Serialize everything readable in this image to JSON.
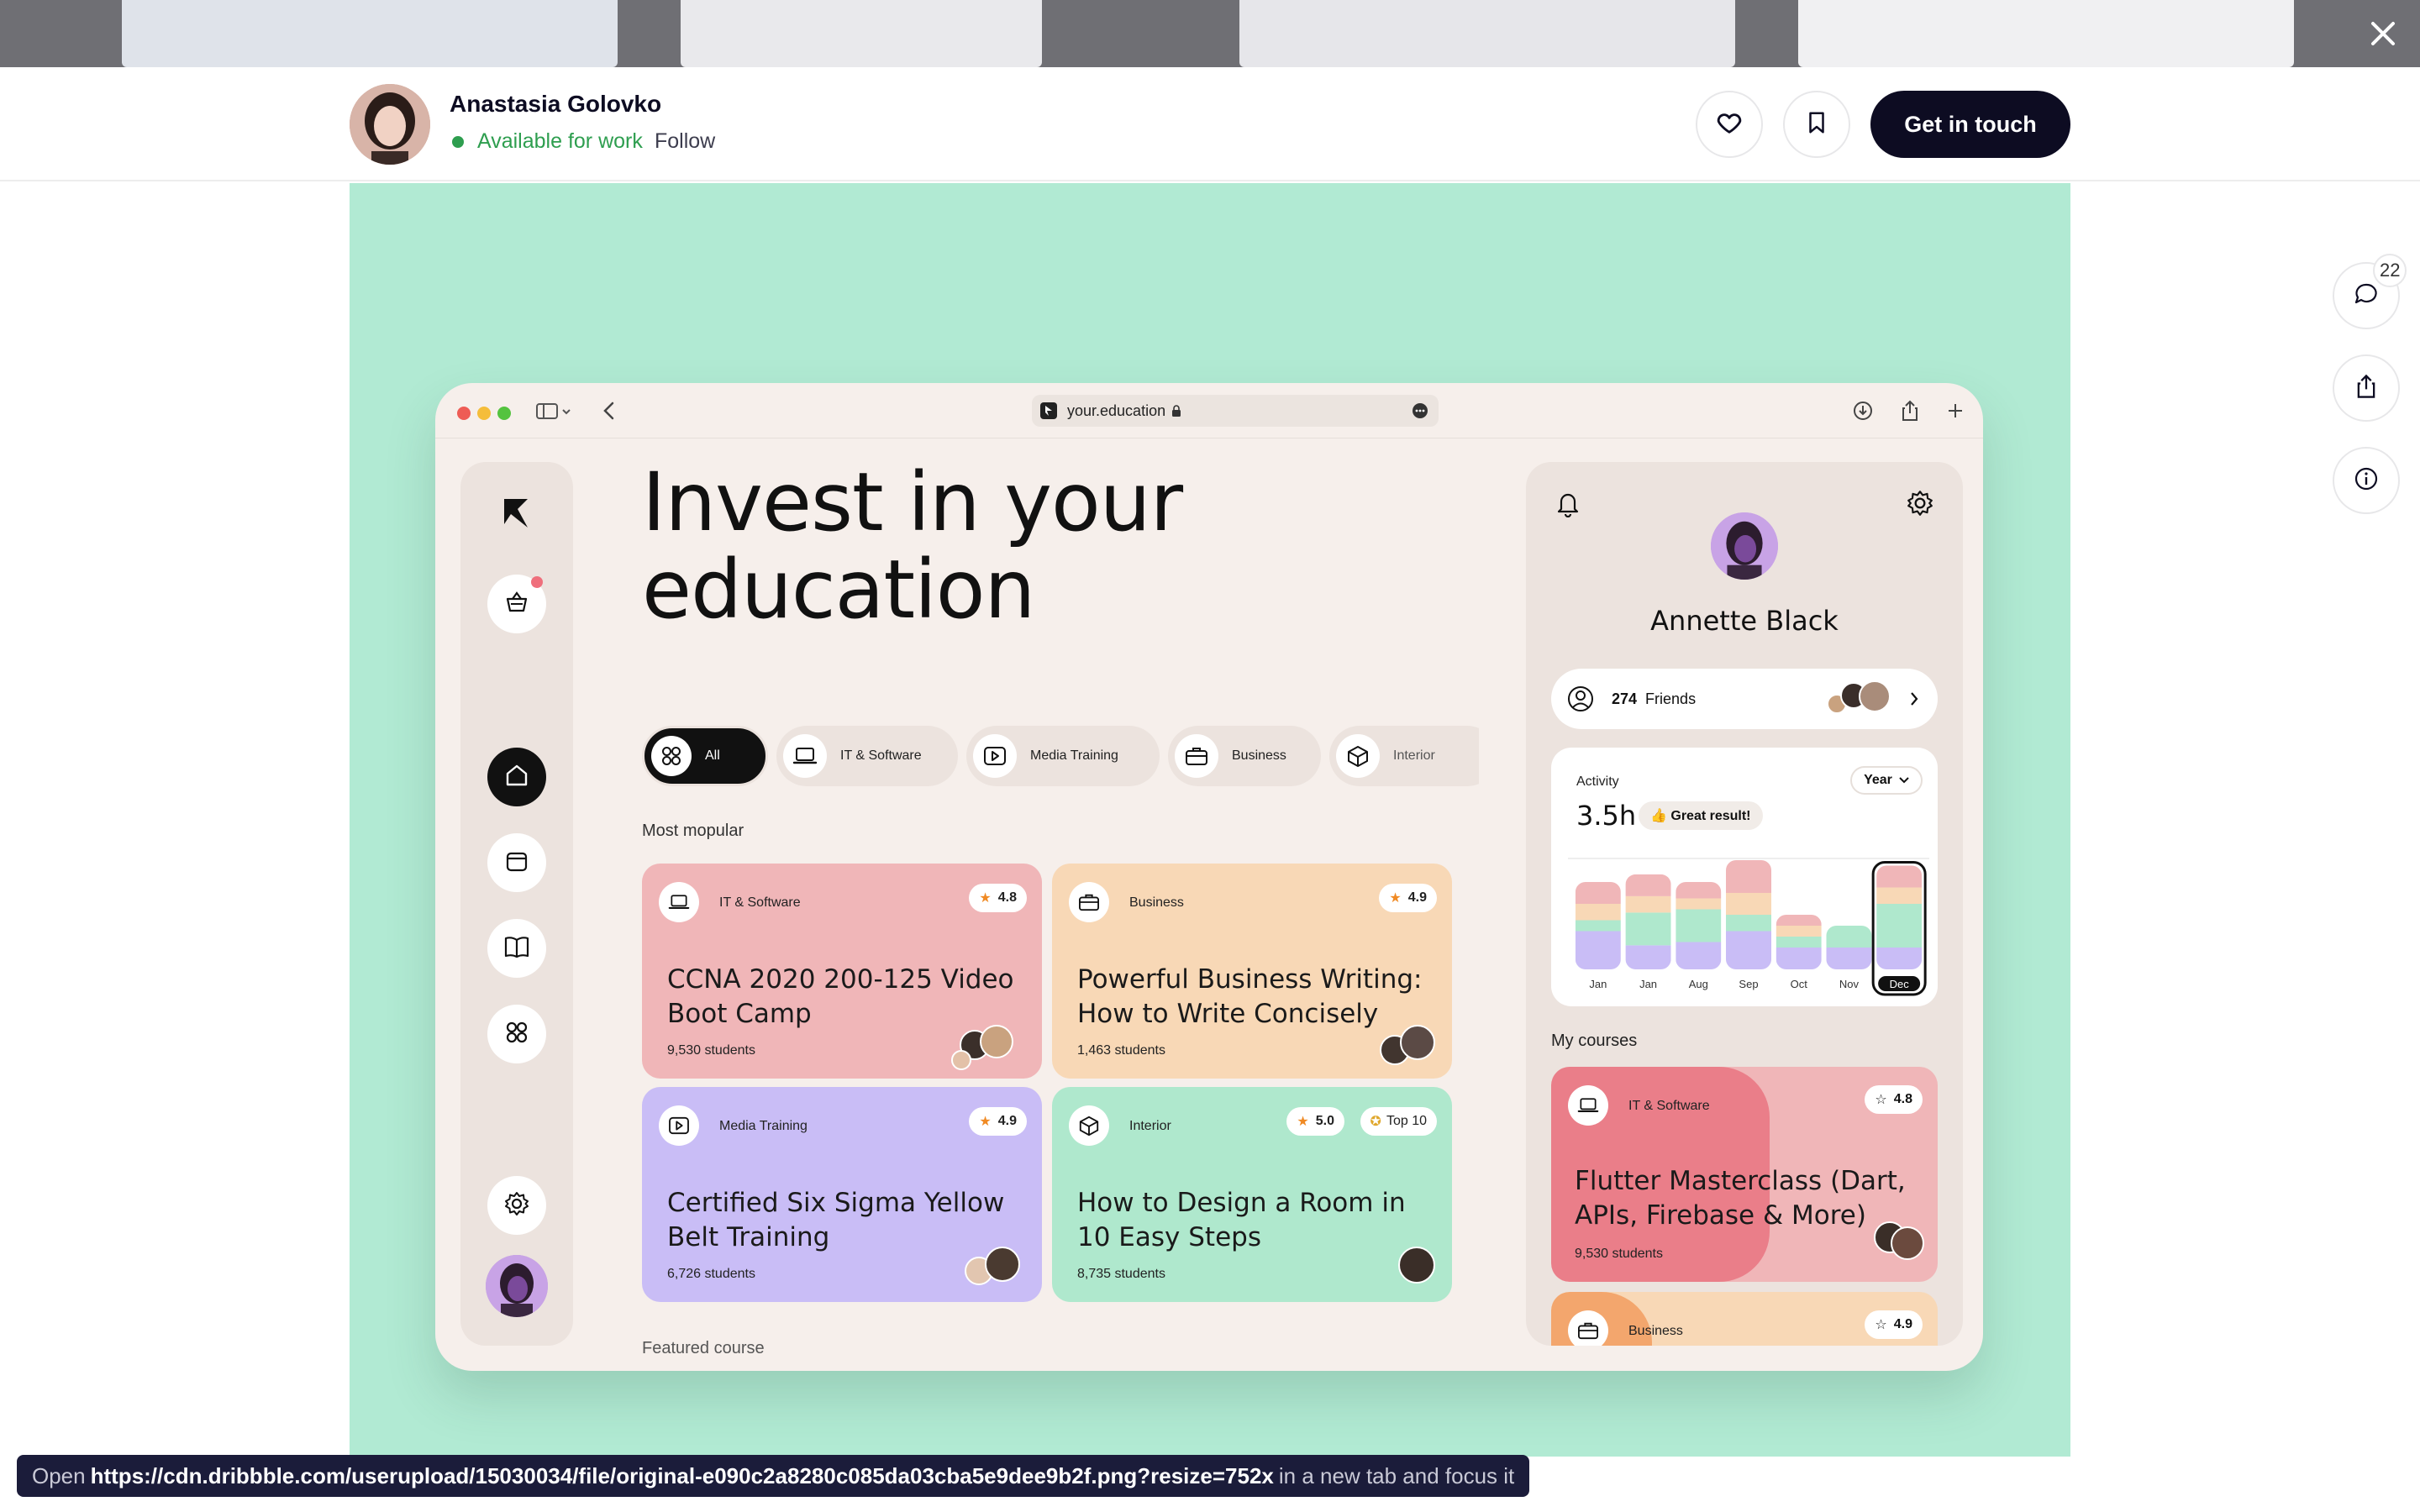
{
  "designer": {
    "name": "Anastasia Golovko",
    "status": "Available for work",
    "follow_label": "Follow",
    "cta_label": "Get in touch"
  },
  "rail": {
    "comment_count": "22"
  },
  "status_bar": {
    "prefix": "Open",
    "url": "https://cdn.dribbble.com/userupload/15030034/file/original-e090c2a8280c085da03cba5e9dee9b2f.png?resize=752x",
    "suffix": "in a new tab and focus it"
  },
  "browser": {
    "url": "your.education"
  },
  "app": {
    "headline_line1": "Invest in your",
    "headline_line2": "education",
    "chips": [
      {
        "label": "All",
        "icon": "grid-icon"
      },
      {
        "label": "IT & Software",
        "icon": "laptop-icon"
      },
      {
        "label": "Media Training",
        "icon": "play-icon"
      },
      {
        "label": "Business",
        "icon": "briefcase-icon"
      },
      {
        "label": "Interior",
        "icon": "box-icon"
      }
    ],
    "popular_label": "Most mopular",
    "featured_label": "Featured course",
    "courses": [
      {
        "category": "IT & Software",
        "rating": "4.8",
        "title": "CCNA 2020 200-125 Video Boot Camp",
        "students": "9,530 students",
        "color": "#f0b6b8"
      },
      {
        "category": "Business",
        "rating": "4.9",
        "title": "Powerful Business Writing: How to Write Concisely",
        "students": "1,463 students",
        "color": "#f8d8b6"
      },
      {
        "category": "Media Training",
        "rating": "4.9",
        "title": "Certified Six Sigma Yellow Belt Training",
        "students": "6,726 students",
        "color": "#c9bdf6"
      },
      {
        "category": "Interior",
        "rating": "5.0",
        "badge": "Top 10",
        "title": "How to Design a Room in 10 Easy Steps",
        "students": "8,735 students",
        "color": "#afe8cd"
      }
    ],
    "profile": {
      "name": "Annette Black",
      "friends_count": "274",
      "friends_label": "Friends"
    },
    "activity": {
      "label": "Activity",
      "period": "Year",
      "hours": "3.5h",
      "badge": "👍 Great result!"
    },
    "my_courses_label": "My courses",
    "my_courses": [
      {
        "category": "IT & Software",
        "rating": "4.8",
        "title": "Flutter Masterclass (Dart, APIs, Firebase & More)",
        "students": "9,530 students"
      },
      {
        "category": "Business",
        "rating": "4.9"
      }
    ]
  },
  "chart_data": {
    "type": "bar",
    "stacked": true,
    "categories": [
      "Jan",
      "Jan",
      "Aug",
      "Sep",
      "Oct",
      "Nov",
      "Dec"
    ],
    "highlighted": "Dec",
    "series": [
      {
        "color": "#c9bdf6",
        "values": [
          0.35,
          0.22,
          0.25,
          0.35,
          0.2,
          0.2,
          0.2
        ]
      },
      {
        "color": "#afe8cd",
        "values": [
          0.1,
          0.3,
          0.3,
          0.15,
          0.1,
          0.2,
          0.4
        ]
      },
      {
        "color": "#f8d8b6",
        "values": [
          0.15,
          0.15,
          0.1,
          0.2,
          0.1,
          0.0,
          0.15
        ]
      },
      {
        "color": "#f0b6b8",
        "values": [
          0.2,
          0.2,
          0.15,
          0.3,
          0.1,
          0.0,
          0.2
        ]
      }
    ],
    "colors": {
      "accent_dark": "#111111"
    }
  }
}
